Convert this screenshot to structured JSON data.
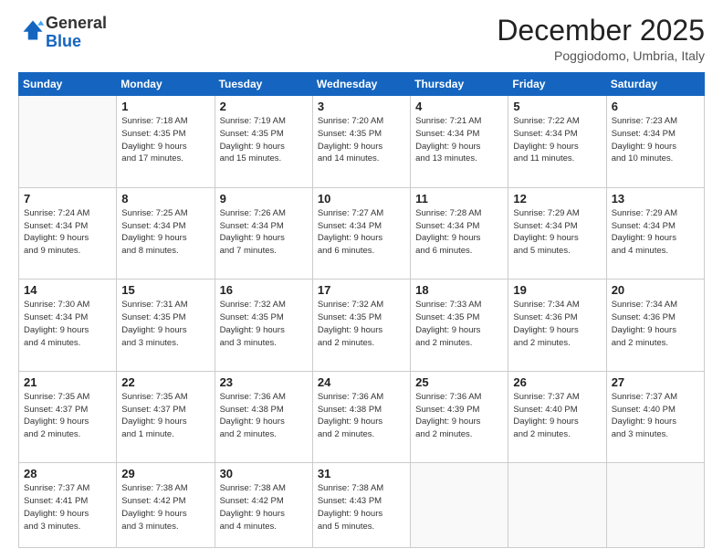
{
  "logo": {
    "general": "General",
    "blue": "Blue"
  },
  "header": {
    "month": "December 2025",
    "location": "Poggiodomo, Umbria, Italy"
  },
  "days_of_week": [
    "Sunday",
    "Monday",
    "Tuesday",
    "Wednesday",
    "Thursday",
    "Friday",
    "Saturday"
  ],
  "weeks": [
    [
      {
        "day": "",
        "info": ""
      },
      {
        "day": "1",
        "info": "Sunrise: 7:18 AM\nSunset: 4:35 PM\nDaylight: 9 hours\nand 17 minutes."
      },
      {
        "day": "2",
        "info": "Sunrise: 7:19 AM\nSunset: 4:35 PM\nDaylight: 9 hours\nand 15 minutes."
      },
      {
        "day": "3",
        "info": "Sunrise: 7:20 AM\nSunset: 4:35 PM\nDaylight: 9 hours\nand 14 minutes."
      },
      {
        "day": "4",
        "info": "Sunrise: 7:21 AM\nSunset: 4:34 PM\nDaylight: 9 hours\nand 13 minutes."
      },
      {
        "day": "5",
        "info": "Sunrise: 7:22 AM\nSunset: 4:34 PM\nDaylight: 9 hours\nand 11 minutes."
      },
      {
        "day": "6",
        "info": "Sunrise: 7:23 AM\nSunset: 4:34 PM\nDaylight: 9 hours\nand 10 minutes."
      }
    ],
    [
      {
        "day": "7",
        "info": "Sunrise: 7:24 AM\nSunset: 4:34 PM\nDaylight: 9 hours\nand 9 minutes."
      },
      {
        "day": "8",
        "info": "Sunrise: 7:25 AM\nSunset: 4:34 PM\nDaylight: 9 hours\nand 8 minutes."
      },
      {
        "day": "9",
        "info": "Sunrise: 7:26 AM\nSunset: 4:34 PM\nDaylight: 9 hours\nand 7 minutes."
      },
      {
        "day": "10",
        "info": "Sunrise: 7:27 AM\nSunset: 4:34 PM\nDaylight: 9 hours\nand 6 minutes."
      },
      {
        "day": "11",
        "info": "Sunrise: 7:28 AM\nSunset: 4:34 PM\nDaylight: 9 hours\nand 6 minutes."
      },
      {
        "day": "12",
        "info": "Sunrise: 7:29 AM\nSunset: 4:34 PM\nDaylight: 9 hours\nand 5 minutes."
      },
      {
        "day": "13",
        "info": "Sunrise: 7:29 AM\nSunset: 4:34 PM\nDaylight: 9 hours\nand 4 minutes."
      }
    ],
    [
      {
        "day": "14",
        "info": "Sunrise: 7:30 AM\nSunset: 4:34 PM\nDaylight: 9 hours\nand 4 minutes."
      },
      {
        "day": "15",
        "info": "Sunrise: 7:31 AM\nSunset: 4:35 PM\nDaylight: 9 hours\nand 3 minutes."
      },
      {
        "day": "16",
        "info": "Sunrise: 7:32 AM\nSunset: 4:35 PM\nDaylight: 9 hours\nand 3 minutes."
      },
      {
        "day": "17",
        "info": "Sunrise: 7:32 AM\nSunset: 4:35 PM\nDaylight: 9 hours\nand 2 minutes."
      },
      {
        "day": "18",
        "info": "Sunrise: 7:33 AM\nSunset: 4:35 PM\nDaylight: 9 hours\nand 2 minutes."
      },
      {
        "day": "19",
        "info": "Sunrise: 7:34 AM\nSunset: 4:36 PM\nDaylight: 9 hours\nand 2 minutes."
      },
      {
        "day": "20",
        "info": "Sunrise: 7:34 AM\nSunset: 4:36 PM\nDaylight: 9 hours\nand 2 minutes."
      }
    ],
    [
      {
        "day": "21",
        "info": "Sunrise: 7:35 AM\nSunset: 4:37 PM\nDaylight: 9 hours\nand 2 minutes."
      },
      {
        "day": "22",
        "info": "Sunrise: 7:35 AM\nSunset: 4:37 PM\nDaylight: 9 hours\nand 1 minute."
      },
      {
        "day": "23",
        "info": "Sunrise: 7:36 AM\nSunset: 4:38 PM\nDaylight: 9 hours\nand 2 minutes."
      },
      {
        "day": "24",
        "info": "Sunrise: 7:36 AM\nSunset: 4:38 PM\nDaylight: 9 hours\nand 2 minutes."
      },
      {
        "day": "25",
        "info": "Sunrise: 7:36 AM\nSunset: 4:39 PM\nDaylight: 9 hours\nand 2 minutes."
      },
      {
        "day": "26",
        "info": "Sunrise: 7:37 AM\nSunset: 4:40 PM\nDaylight: 9 hours\nand 2 minutes."
      },
      {
        "day": "27",
        "info": "Sunrise: 7:37 AM\nSunset: 4:40 PM\nDaylight: 9 hours\nand 3 minutes."
      }
    ],
    [
      {
        "day": "28",
        "info": "Sunrise: 7:37 AM\nSunset: 4:41 PM\nDaylight: 9 hours\nand 3 minutes."
      },
      {
        "day": "29",
        "info": "Sunrise: 7:38 AM\nSunset: 4:42 PM\nDaylight: 9 hours\nand 3 minutes."
      },
      {
        "day": "30",
        "info": "Sunrise: 7:38 AM\nSunset: 4:42 PM\nDaylight: 9 hours\nand 4 minutes."
      },
      {
        "day": "31",
        "info": "Sunrise: 7:38 AM\nSunset: 4:43 PM\nDaylight: 9 hours\nand 5 minutes."
      },
      {
        "day": "",
        "info": ""
      },
      {
        "day": "",
        "info": ""
      },
      {
        "day": "",
        "info": ""
      }
    ]
  ]
}
